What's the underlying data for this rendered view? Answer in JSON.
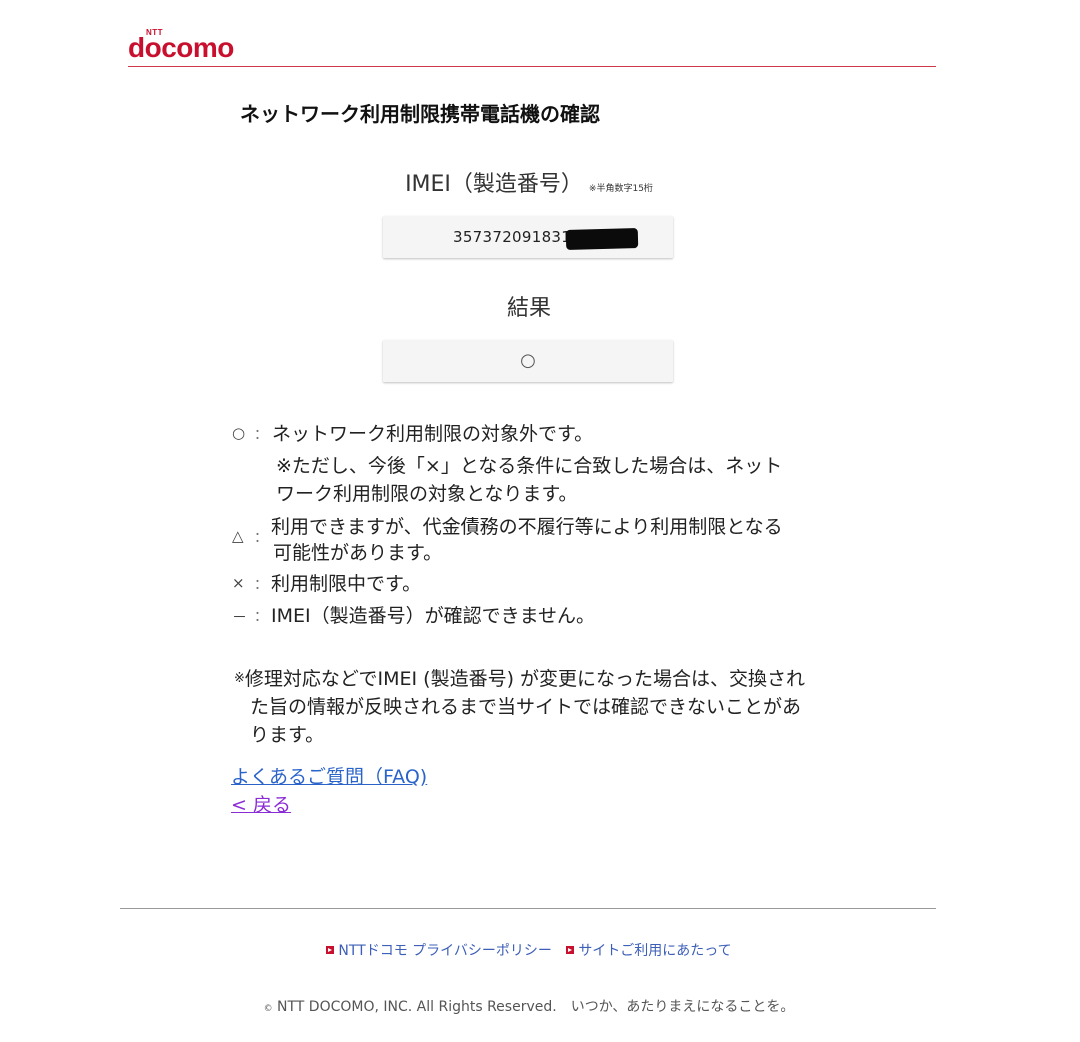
{
  "header": {
    "brand_ntt": "NTT",
    "brand_name": "docomo"
  },
  "title": "ネットワーク利用制限携帯電話機の確認",
  "imei": {
    "label": "IMEI（製造番号）",
    "note": "※半角数字15桁",
    "value": "357372091831"
  },
  "result": {
    "label": "結果",
    "value": "○"
  },
  "legend": [
    {
      "symbol": "○",
      "colon": "：",
      "lines": [
        "ネットワーク利用制限の対象外です。",
        "※ただし、今後「×」となる条件に合致した場合は、ネット",
        "ワーク利用制限の対象となります。"
      ]
    },
    {
      "symbol": "△",
      "colon": "：",
      "lines": [
        "利用できますが、代金債務の不履行等により利用制限となる",
        "可能性があります。"
      ]
    },
    {
      "symbol": "×",
      "colon": "：",
      "lines": [
        "利用制限中です。"
      ]
    },
    {
      "symbol": "－",
      "colon": "：",
      "lines": [
        "IMEI（製造番号）が確認できません。"
      ]
    }
  ],
  "notice": {
    "mark": "※",
    "lines": [
      "修理対応などでIMEI (製造番号) が変更になった場合は、交換され",
      "た旨の情報が反映されるまで当サイトでは確認できないことがあ",
      "ります。"
    ]
  },
  "links": {
    "faq": "よくあるご質問（FAQ)",
    "back": "< 戻る"
  },
  "footer": {
    "privacy": "NTTドコモ プライバシーポリシー",
    "terms": "サイトご利用にあたって",
    "copyright_symbol": "©",
    "copyright": "NTT DOCOMO, INC. All Rights Reserved.　いつか、あたりまえになることを。"
  },
  "colors": {
    "brand": "#c8102e",
    "link": "#2a63c9",
    "visited_link": "#8a2bd6"
  }
}
